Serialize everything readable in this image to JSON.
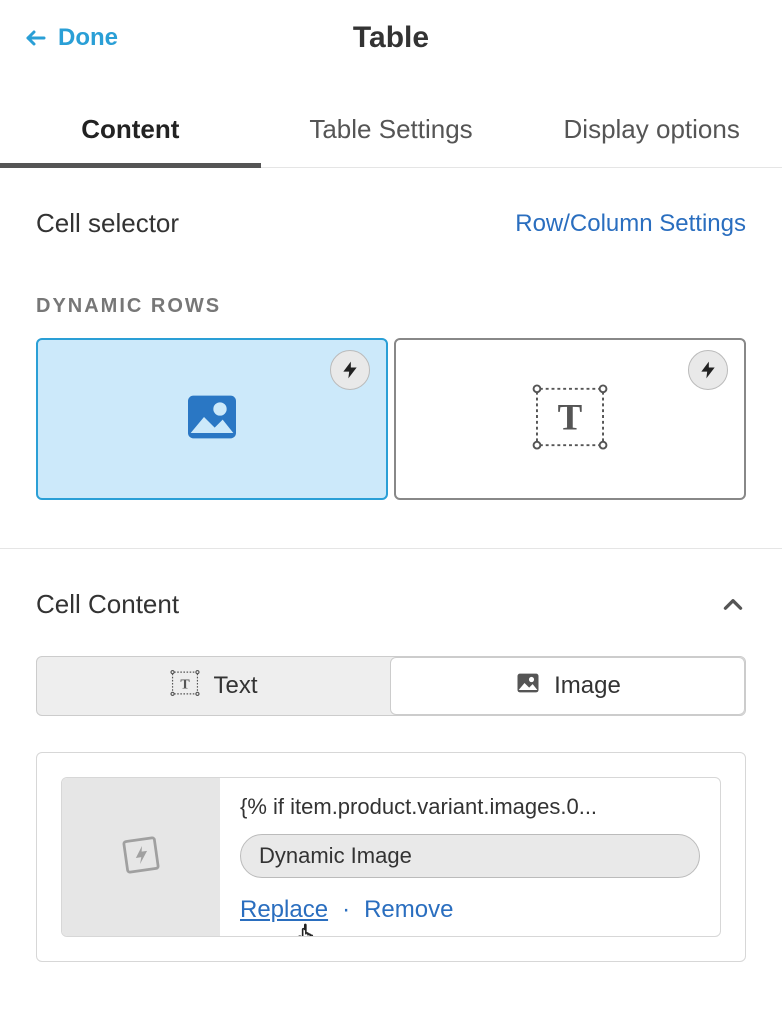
{
  "header": {
    "done": "Done",
    "title": "Table"
  },
  "tabs": {
    "content": "Content",
    "table_settings": "Table Settings",
    "display_options": "Display options"
  },
  "content": {
    "cell_selector": "Cell selector",
    "rowcol_link": "Row/Column Settings",
    "dynamic_rows_label": "DYNAMIC ROWS"
  },
  "cell_content": {
    "title": "Cell Content",
    "seg_text": "Text",
    "seg_image": "Image",
    "asset_title": "{% if item.product.variant.images.0...",
    "pill": "Dynamic Image",
    "replace": "Replace",
    "remove": "Remove"
  }
}
